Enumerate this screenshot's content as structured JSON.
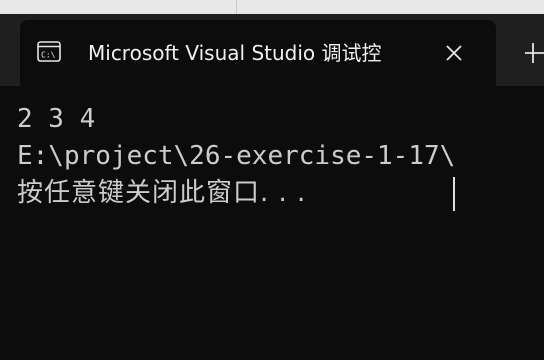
{
  "window": {
    "tab_title": "Microsoft Visual Studio 调试控",
    "tab_icon": "console-app-icon",
    "close_icon": "close-icon",
    "new_tab_icon": "plus-icon"
  },
  "console": {
    "lines": [
      "2 3 4",
      "E:\\project\\26-exercise-1-17\\",
      "按任意键关闭此窗口. . ."
    ]
  },
  "colors": {
    "background": "#0c0c0c",
    "titlebar": "#1f1f1f",
    "text": "#cccccc"
  }
}
